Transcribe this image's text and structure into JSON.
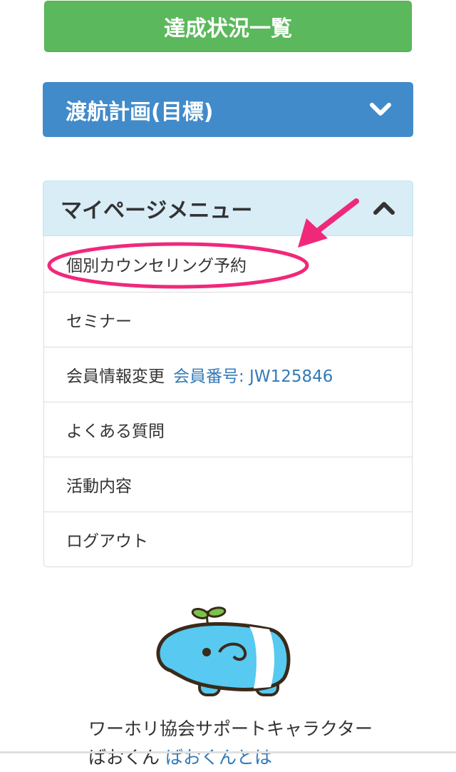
{
  "buttons": {
    "achievement_label": "達成状況一覧"
  },
  "travel_plan": {
    "label": "渡航計画(目標)"
  },
  "mypage_menu": {
    "header": "マイページメニュー",
    "items": [
      {
        "label": "個別カウンセリング予約"
      },
      {
        "label": "セミナー"
      },
      {
        "label": "会員情報変更",
        "member_number": "会員番号: JW125846"
      },
      {
        "label": "よくある質問"
      },
      {
        "label": "活動内容"
      },
      {
        "label": "ログアウト"
      }
    ]
  },
  "support_character": {
    "caption_line1": "ワーホリ協会サポートキャラクター",
    "caption_line2_name": "ばおくん",
    "caption_line2_link": "ばおくんとは"
  },
  "icons": {
    "travel_plan_toggle": "chevron-down-icon",
    "menu_toggle": "chevron-up-icon",
    "annotation_arrow": "arrow-icon"
  },
  "colors": {
    "green_button": "#5cb85c",
    "blue_panel": "#428bca",
    "menu_header_bg": "#d9edf7",
    "link": "#337ab7",
    "annotation": "#f0287a",
    "mascot_body": "#58c9f0"
  }
}
